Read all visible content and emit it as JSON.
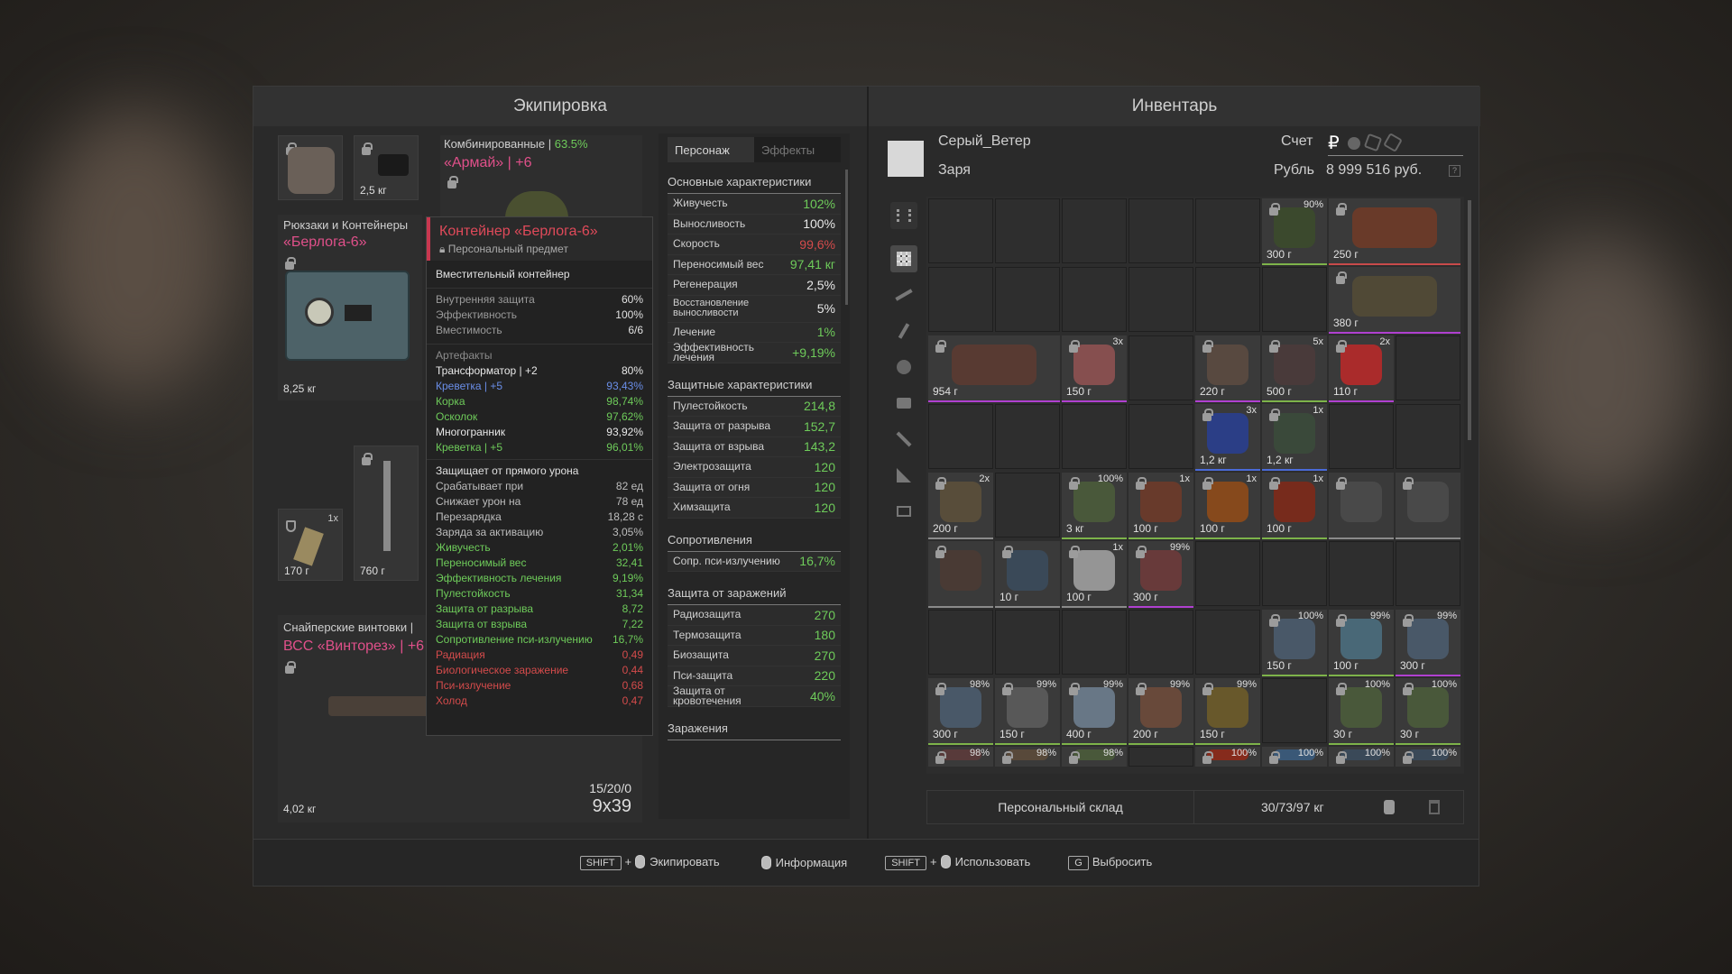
{
  "equipment": {
    "title": "Экипировка",
    "mask_weight": "",
    "scope_weight": "2,5 кг",
    "armor": {
      "label": "Комбинированные",
      "value": "63.5%",
      "name": "«Армай»",
      "upgrade": "+6"
    },
    "backpack": {
      "label": "Рюкзаки и Контейнеры",
      "name": "«Берлога-6»",
      "weight": "8,25 кг"
    },
    "artifact_slot": {
      "count": "1x",
      "weight": "170 г"
    },
    "knife": {
      "weight": "760 г"
    },
    "rifle": {
      "label": "Снайперские винтовки",
      "name": "ВСС «Винторез»",
      "upgrade": "+6",
      "weight": "4,02 кг",
      "ammo": "15/20/0",
      "caliber": "9x39"
    }
  },
  "tooltip": {
    "title": "Контейнер «Берлога-6»",
    "personal": "Персональный предмет",
    "subtitle": "Вместительный контейнер",
    "base": [
      {
        "k": "Внутренняя защита",
        "v": "60%"
      },
      {
        "k": "Эффективность",
        "v": "100%"
      },
      {
        "k": "Вместимость",
        "v": "6/6"
      }
    ],
    "artifacts_header": "Артефакты",
    "artifacts": [
      {
        "k": "Трансформатор | +2",
        "v": "80%",
        "c": "white"
      },
      {
        "k": "Креветка | +5",
        "v": "93,43%",
        "c": "blue"
      },
      {
        "k": "Корка",
        "v": "98,74%",
        "c": "green"
      },
      {
        "k": "Осколок",
        "v": "97,62%",
        "c": "green"
      },
      {
        "k": "Многогранник",
        "v": "93,92%",
        "c": "white"
      },
      {
        "k": "Креветка | +5",
        "v": "96,01%",
        "c": "green"
      }
    ],
    "protect_header": "Защищает от прямого урона",
    "protect": [
      {
        "k": "Срабатывает при",
        "v": "82 ед",
        "c": "grey"
      },
      {
        "k": "Снижает урон на",
        "v": "78 ед",
        "c": "grey"
      },
      {
        "k": "Перезарядка",
        "v": "18,28 с",
        "c": "grey"
      },
      {
        "k": "Заряда за активацию",
        "v": "3,05%",
        "c": "grey"
      }
    ],
    "effects": [
      {
        "k": "Живучесть",
        "v": "2,01%",
        "c": "green"
      },
      {
        "k": "Переносимый вес",
        "v": "32,41",
        "c": "green"
      },
      {
        "k": "Эффективность лечения",
        "v": "9,19%",
        "c": "green"
      },
      {
        "k": "Пулестойкость",
        "v": "31,34",
        "c": "green"
      },
      {
        "k": "Защита от разрыва",
        "v": "8,72",
        "c": "green"
      },
      {
        "k": "Защита от взрыва",
        "v": "7,22",
        "c": "green"
      },
      {
        "k": "Сопротивление пси-излучению",
        "v": "16,7%",
        "c": "green"
      },
      {
        "k": "Радиация",
        "v": "0,49",
        "c": "red"
      },
      {
        "k": "Биологическое заражение",
        "v": "0,44",
        "c": "red"
      },
      {
        "k": "Пси-излучение",
        "v": "0,68",
        "c": "red"
      },
      {
        "k": "Холод",
        "v": "0,47",
        "c": "red"
      }
    ]
  },
  "stats": {
    "tabs": [
      "Персонаж",
      "Эффекты"
    ],
    "main_title": "Основные характеристики",
    "main": [
      {
        "k": "Живучесть",
        "v": "102%",
        "c": "green"
      },
      {
        "k": "Выносливость",
        "v": "100%",
        "c": "white"
      },
      {
        "k": "Скорость",
        "v": "99,6%",
        "c": "red"
      },
      {
        "k": "Переносимый вес",
        "v": "97,41 кг",
        "c": "green"
      },
      {
        "k": "Регенерация",
        "v": "2,5%",
        "c": "white"
      },
      {
        "k": "Восстановление выносливости",
        "v": "5%",
        "c": "white"
      },
      {
        "k": "Лечение",
        "v": "1%",
        "c": "green"
      },
      {
        "k": "Эффективность лечения",
        "v": "+9,19%",
        "c": "green"
      }
    ],
    "prot_title": "Защитные характеристики",
    "prot": [
      {
        "k": "Пулестойкость",
        "v": "214,8"
      },
      {
        "k": "Защита от разрыва",
        "v": "152,7"
      },
      {
        "k": "Защита от взрыва",
        "v": "143,2"
      },
      {
        "k": "Электрозащита",
        "v": "120"
      },
      {
        "k": "Защита от огня",
        "v": "120"
      },
      {
        "k": "Химзащита",
        "v": "120"
      }
    ],
    "res_title": "Сопротивления",
    "res": [
      {
        "k": "Сопр. пси-излучению",
        "v": "16,7%"
      }
    ],
    "inf_title": "Защита от заражений",
    "inf": [
      {
        "k": "Радиозащита",
        "v": "270"
      },
      {
        "k": "Термозащита",
        "v": "180"
      },
      {
        "k": "Биозащита",
        "v": "270"
      },
      {
        "k": "Пси-защита",
        "v": "220"
      },
      {
        "k": "Защита от кровотечения",
        "v": "40%"
      }
    ],
    "cont_title": "Заражения"
  },
  "inventory": {
    "title": "Инвентарь",
    "player": "Серый_Ветер",
    "faction": "Заря",
    "account_label": "Счет",
    "currency": "Рубль",
    "balance": "8 999 516 руб.",
    "currency_symbol": "₽",
    "storage": "Персональный склад",
    "weight": "30/73/97 кг",
    "items": [
      {
        "c": 5,
        "r": 0,
        "w": 1,
        "h": 1,
        "wt": "300 г",
        "p": "90%",
        "col": "#3b4a2c",
        "b": "#7db34a"
      },
      {
        "c": 6,
        "r": 0,
        "w": 2,
        "h": 1,
        "wt": "250 г",
        "p": "",
        "col": "#6b3a28",
        "b": "#c84a4a"
      },
      {
        "c": 6,
        "r": 1,
        "w": 2,
        "h": 1,
        "wt": "380 г",
        "p": "",
        "col": "#514a36",
        "b": "#b040d0"
      },
      {
        "c": 0,
        "r": 2,
        "w": 2,
        "h": 1,
        "wt": "954 г",
        "p": "",
        "col": "#5a3a32",
        "b": "#b040d0"
      },
      {
        "c": 2,
        "r": 2,
        "w": 1,
        "h": 1,
        "wt": "150 г",
        "p": "3x",
        "col": "#8a5050",
        "b": "#b040d0"
      },
      {
        "c": 4,
        "r": 2,
        "w": 1,
        "h": 1,
        "wt": "220 г",
        "p": "",
        "col": "#5a4a40",
        "b": "#b040d0"
      },
      {
        "c": 5,
        "r": 2,
        "w": 1,
        "h": 1,
        "wt": "500 г",
        "p": "5x",
        "col": "#4a3a3a",
        "b": "#7db34a"
      },
      {
        "c": 6,
        "r": 2,
        "w": 1,
        "h": 1,
        "wt": "110 г",
        "p": "2x",
        "col": "#b02a2a",
        "b": "#b040d0"
      },
      {
        "c": 4,
        "r": 3,
        "w": 1,
        "h": 1,
        "wt": "1,2 кг",
        "p": "3x",
        "col": "#2a3e8a",
        "b": "#4a6ad8"
      },
      {
        "c": 5,
        "r": 3,
        "w": 1,
        "h": 1,
        "wt": "1,2 кг",
        "p": "1x",
        "col": "#3a4a3a",
        "b": "#4a6ad8"
      },
      {
        "c": 0,
        "r": 4,
        "w": 1,
        "h": 1,
        "wt": "200 г",
        "p": "2x",
        "col": "#5a4e3a",
        "b": "#8a8a8a"
      },
      {
        "c": 2,
        "r": 4,
        "w": 1,
        "h": 1,
        "wt": "3 кг",
        "p": "100%",
        "col": "#4a5a3a",
        "b": "#7db34a"
      },
      {
        "c": 3,
        "r": 4,
        "w": 1,
        "h": 1,
        "wt": "100 г",
        "p": "1x",
        "col": "#6a3a2a",
        "b": "#7db34a"
      },
      {
        "c": 4,
        "r": 4,
        "w": 1,
        "h": 1,
        "wt": "100 г",
        "p": "1x",
        "col": "#8a4a1a",
        "b": "#7db34a"
      },
      {
        "c": 5,
        "r": 4,
        "w": 1,
        "h": 1,
        "wt": "100 г",
        "p": "1x",
        "col": "#7a2a1a",
        "b": "#7db34a"
      },
      {
        "c": 6,
        "r": 4,
        "w": 1,
        "h": 1,
        "wt": "",
        "p": "",
        "col": "#4a4a4a",
        "b": "#8a8a8a"
      },
      {
        "c": 7,
        "r": 4,
        "w": 1,
        "h": 1,
        "wt": "",
        "p": "",
        "col": "#4a4a4a",
        "b": "#8a8a8a"
      },
      {
        "c": 0,
        "r": 5,
        "w": 1,
        "h": 1,
        "wt": "",
        "p": "",
        "col": "#4a3a34",
        "b": "#8a8a8a"
      },
      {
        "c": 1,
        "r": 5,
        "w": 1,
        "h": 1,
        "wt": "10 г",
        "p": "",
        "col": "#3a4a5a",
        "b": "#8a8a8a"
      },
      {
        "c": 2,
        "r": 5,
        "w": 1,
        "h": 1,
        "wt": "100 г",
        "p": "1x",
        "col": "#9a9a9a",
        "b": "#8a8a8a"
      },
      {
        "c": 3,
        "r": 5,
        "w": 1,
        "h": 1,
        "wt": "300 г",
        "p": "99%",
        "col": "#6a3a3a",
        "b": "#b040d0"
      },
      {
        "c": 5,
        "r": 6,
        "w": 1,
        "h": 1,
        "wt": "150 г",
        "p": "100%",
        "col": "#4a5a6a",
        "b": "#7db34a"
      },
      {
        "c": 6,
        "r": 6,
        "w": 1,
        "h": 1,
        "wt": "100 г",
        "p": "99%",
        "col": "#4a6a7a",
        "b": "#7db34a"
      },
      {
        "c": 7,
        "r": 6,
        "w": 1,
        "h": 1,
        "wt": "300 г",
        "p": "99%",
        "col": "#4a5a6a",
        "b": "#b040d0"
      },
      {
        "c": 0,
        "r": 7,
        "w": 1,
        "h": 1,
        "wt": "300 г",
        "p": "98%",
        "col": "#4a5a6a",
        "b": "#7db34a"
      },
      {
        "c": 1,
        "r": 7,
        "w": 1,
        "h": 1,
        "wt": "150 г",
        "p": "99%",
        "col": "#5a5a5a",
        "b": "#7db34a"
      },
      {
        "c": 2,
        "r": 7,
        "w": 1,
        "h": 1,
        "wt": "400 г",
        "p": "99%",
        "col": "#6a7a8a",
        "b": "#7db34a"
      },
      {
        "c": 3,
        "r": 7,
        "w": 1,
        "h": 1,
        "wt": "200 г",
        "p": "99%",
        "col": "#6a4a3a",
        "b": "#7db34a"
      },
      {
        "c": 4,
        "r": 7,
        "w": 1,
        "h": 1,
        "wt": "150 г",
        "p": "99%",
        "col": "#6a5a2a",
        "b": "#7db34a"
      },
      {
        "c": 6,
        "r": 7,
        "w": 1,
        "h": 1,
        "wt": "30 г",
        "p": "100%",
        "col": "#4a5a3a",
        "b": "#7db34a"
      },
      {
        "c": 7,
        "r": 7,
        "w": 1,
        "h": 1,
        "wt": "30 г",
        "p": "100%",
        "col": "#4a5a3a",
        "b": "#7db34a"
      },
      {
        "c": 0,
        "r": 8,
        "w": 1,
        "h": 0.3,
        "wt": "",
        "p": "98%",
        "col": "#5a3a3a",
        "b": "#3a3a3a"
      },
      {
        "c": 1,
        "r": 8,
        "w": 1,
        "h": 0.3,
        "wt": "",
        "p": "98%",
        "col": "#5a4a3a",
        "b": "#3a3a3a"
      },
      {
        "c": 2,
        "r": 8,
        "w": 1,
        "h": 0.3,
        "wt": "",
        "p": "98%",
        "col": "#4a5a3a",
        "b": "#3a3a3a"
      },
      {
        "c": 4,
        "r": 8,
        "w": 1,
        "h": 0.3,
        "wt": "",
        "p": "100%",
        "col": "#8a2a1a",
        "b": "#3a3a3a"
      },
      {
        "c": 5,
        "r": 8,
        "w": 1,
        "h": 0.3,
        "wt": "",
        "p": "100%",
        "col": "#3a5a7a",
        "b": "#3a3a3a"
      },
      {
        "c": 6,
        "r": 8,
        "w": 1,
        "h": 0.3,
        "wt": "",
        "p": "100%",
        "col": "#3a4a5a",
        "b": "#3a3a3a"
      },
      {
        "c": 7,
        "r": 8,
        "w": 1,
        "h": 0.3,
        "wt": "",
        "p": "100%",
        "col": "#3a4a5a",
        "b": "#3a3a3a"
      }
    ]
  },
  "footer": {
    "equip": "Экипировать",
    "info": "Информация",
    "use": "Использовать",
    "drop": "Выбросить",
    "shift": "SHIFT",
    "g": "G"
  }
}
